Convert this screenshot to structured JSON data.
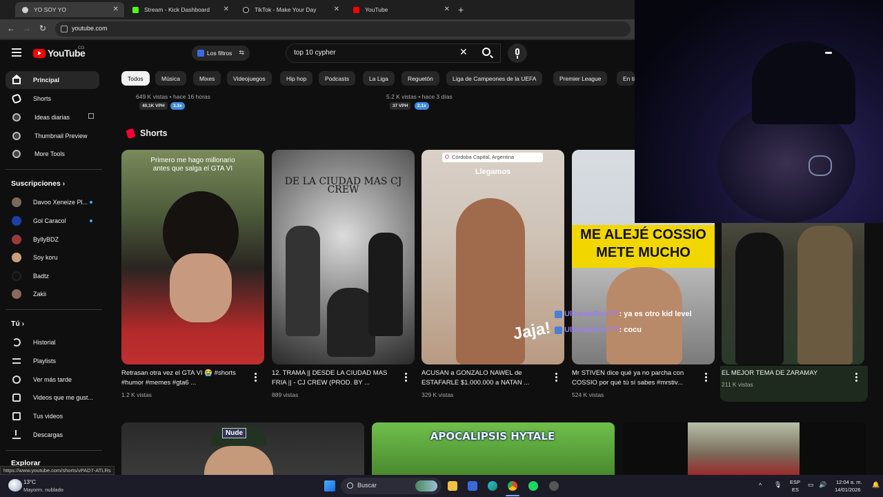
{
  "browser": {
    "tabs": [
      {
        "label": "YO SOY YO",
        "active": true
      },
      {
        "label": "Stream - Kick Dashboard",
        "active": false
      },
      {
        "label": "TikTok - Make Your Day",
        "active": false
      },
      {
        "label": "YouTube",
        "active": false
      }
    ],
    "url": "youtube.com"
  },
  "header": {
    "logo": "YouTube",
    "country": "CO",
    "filters_label": "Los filtros",
    "search_value": "top 10 cypher"
  },
  "sidebar": {
    "main": [
      {
        "label": "Principal",
        "icon": "home-icon"
      },
      {
        "label": "Shorts",
        "icon": "shorts-icon"
      },
      {
        "label": "Ideas diarias",
        "icon": "extension-icon"
      },
      {
        "label": "Thumbnail Preview",
        "icon": "extension-icon"
      },
      {
        "label": "More Tools",
        "icon": "extension-icon"
      }
    ],
    "subs_heading": "Suscripciones",
    "subscriptions": [
      {
        "label": "Davoo Xeneize Pl...",
        "color": "#7a6a5a",
        "new": true
      },
      {
        "label": "Gol Caracol",
        "color": "#1d3fa8",
        "new": true
      },
      {
        "label": "ByllyBDZ",
        "color": "#9a3a3a",
        "new": false
      },
      {
        "label": "Soy koru",
        "color": "#c9a07a",
        "new": false
      },
      {
        "label": "Badtz",
        "color": "#111111",
        "new": false
      },
      {
        "label": "Zakii",
        "color": "#8a6a5a",
        "new": false
      }
    ],
    "you_heading": "Tú",
    "you": [
      {
        "label": "Historial",
        "icon": "history-icon"
      },
      {
        "label": "Playlists",
        "icon": "playlist-icon"
      },
      {
        "label": "Ver más tarde",
        "icon": "clock-icon"
      },
      {
        "label": "Videos que me gust...",
        "icon": "thumbs-up-icon"
      },
      {
        "label": "Tus videos",
        "icon": "video-icon"
      },
      {
        "label": "Descargas",
        "icon": "download-icon"
      }
    ],
    "explore_heading": "Explorar"
  },
  "chips": [
    "Todos",
    "Música",
    "Mixes",
    "Videojuegos",
    "Hip hop",
    "Podcasts",
    "La Liga",
    "Reguetón",
    "Liga de Campeones de la UEFA",
    "Premier League",
    "En ti"
  ],
  "stats": [
    {
      "views": "649 K vistas • hace 16 horas",
      "vph": "40.1K VPH",
      "mult": "3.3x"
    },
    {
      "views": "5.2 K vistas • hace 3 días",
      "vph": "37 VPH",
      "mult": "2.1x"
    }
  ],
  "shorts_heading": "Shorts",
  "shorts": [
    {
      "title": "Retrasan otra vez el GTA VI 😭 #shorts #humor #memes #gta6 ...",
      "views": "1.2 K vistas",
      "overlay": "Primero me hago millonario antes que salga el GTA VI"
    },
    {
      "title": "12. TRAMA || DESDE LA CIUDAD MAS FRIA || - CJ CREW (PROD. BY ...",
      "views": "889 vistas",
      "overlay": "DE LA CIUDAD MAS CJ CREW"
    },
    {
      "title": "ACUSAN a GONZALO NAWEL de ESTAFARLE $1.000.000 a NATAN ...",
      "views": "329 K vistas",
      "overlay": "Córdoba Capital, Argentina",
      "overlay2": "Llegamos",
      "overlay3": "Jaja!"
    },
    {
      "title": "Mr STIVEN dice qué ya no parcha con COSSIO por qué tú sí sabes #mrstiv...",
      "views": "524 K vistas",
      "overlay": "ME ALEJÉ COSSIO METE MUCHO"
    },
    {
      "title": "EL MEJOR TEMA DE ZARAMAY",
      "views": "211 K vistas"
    }
  ],
  "chat": [
    {
      "user": "UltimateBoi777",
      "msg": ": ya es otro kid level"
    },
    {
      "user": "UltimateBoi777",
      "msg": ": cocu"
    }
  ],
  "bottom_row": [
    "Nude",
    "APOCALIPSIS HYTALE",
    ""
  ],
  "status_url": "https://www.youtube.com/shorts/vPAD7-ATLRs",
  "taskbar": {
    "weather_temp": "13°C",
    "weather_desc": "Mayorm. nublado",
    "search_label": "Buscar",
    "lang1": "ESP",
    "lang2": "ES",
    "time": "12:04 a. m.",
    "date": "14/01/2026"
  },
  "webcam": {
    "stars": "★★★★★"
  }
}
